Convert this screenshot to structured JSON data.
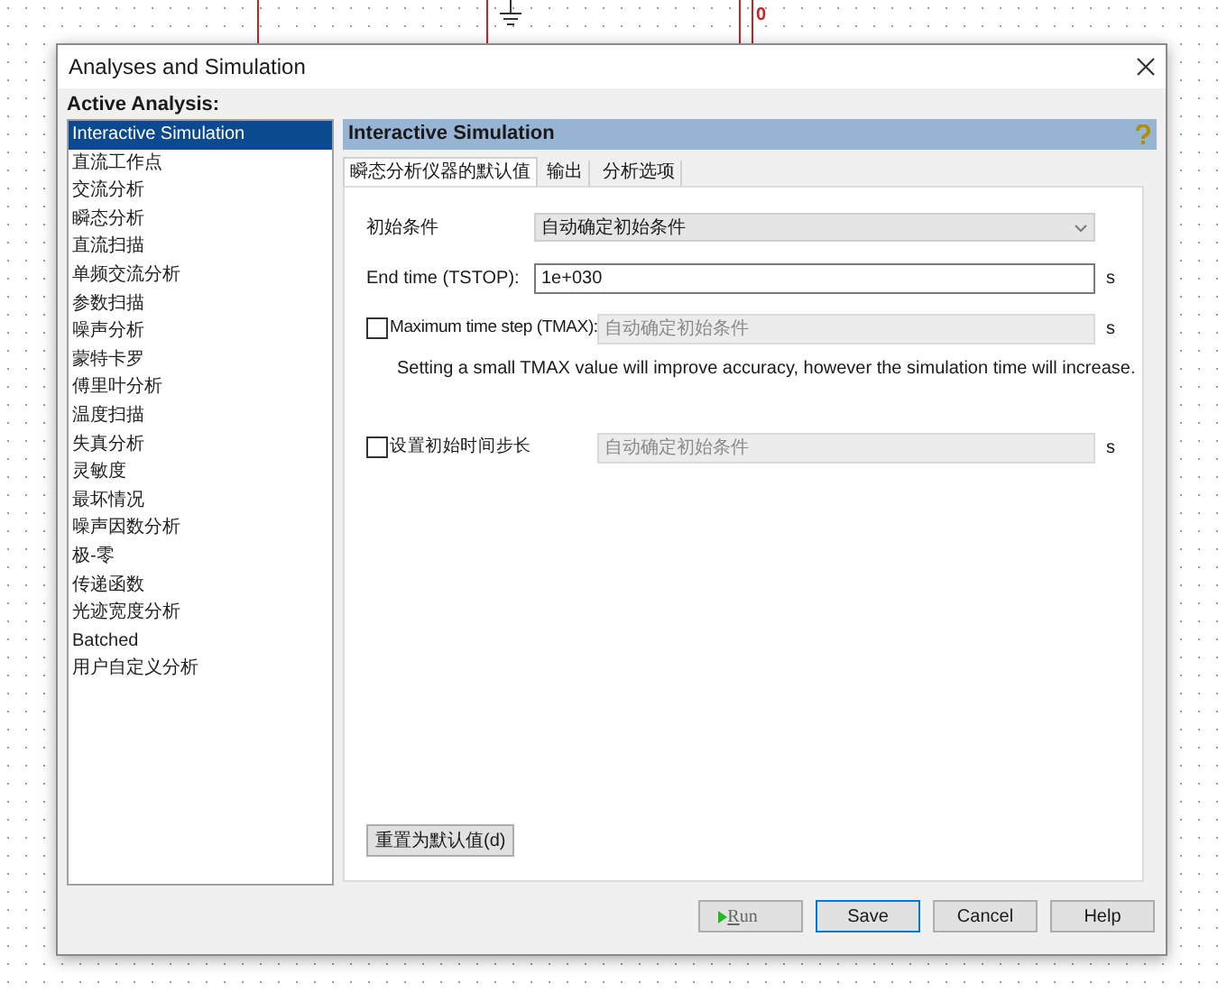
{
  "canvas": {
    "node_label": "0"
  },
  "window": {
    "title": "Analyses and Simulation"
  },
  "sidebar": {
    "heading": "Active Analysis:",
    "items": [
      {
        "label": "Interactive Simulation",
        "selected": true
      },
      {
        "label": "直流工作点",
        "selected": false
      },
      {
        "label": "交流分析",
        "selected": false
      },
      {
        "label": "瞬态分析",
        "selected": false
      },
      {
        "label": "直流扫描",
        "selected": false
      },
      {
        "label": "单频交流分析",
        "selected": false
      },
      {
        "label": "参数扫描",
        "selected": false
      },
      {
        "label": "噪声分析",
        "selected": false
      },
      {
        "label": "蒙特卡罗",
        "selected": false
      },
      {
        "label": "傅里叶分析",
        "selected": false
      },
      {
        "label": "温度扫描",
        "selected": false
      },
      {
        "label": "失真分析",
        "selected": false
      },
      {
        "label": "灵敏度",
        "selected": false
      },
      {
        "label": "最坏情况",
        "selected": false
      },
      {
        "label": "噪声因数分析",
        "selected": false
      },
      {
        "label": "极-零",
        "selected": false
      },
      {
        "label": "传递函数",
        "selected": false
      },
      {
        "label": "光迹宽度分析",
        "selected": false
      },
      {
        "label": "Batched",
        "selected": false
      },
      {
        "label": "用户自定义分析",
        "selected": false
      }
    ]
  },
  "panel": {
    "title": "Interactive Simulation",
    "tabs": [
      {
        "label": "瞬态分析仪器的默认值",
        "selected": true
      },
      {
        "label": "输出",
        "selected": false
      },
      {
        "label": "分析选项",
        "selected": false
      }
    ],
    "fields": [
      {
        "kind": "select",
        "label": "初始条件",
        "value": "自动确定初始条件"
      },
      {
        "kind": "input",
        "label": "End time (TSTOP):",
        "value": "1e+030",
        "unit": "s"
      },
      {
        "kind": "checkbox",
        "label": "Maximum time step (TMAX):",
        "checked": false,
        "disabled": true,
        "value": "自动确定初始条件",
        "unit": "s"
      },
      {
        "kind": "note",
        "text": "Setting a small TMAX value will improve accuracy, however the simulation time will increase."
      },
      {
        "kind": "checkbox",
        "label": "设置初始时间步长",
        "checked": false,
        "disabled": true,
        "value": "自动确定初始条件",
        "unit": "s"
      }
    ],
    "reset_button": "重置为默认值(d)"
  },
  "buttons": [
    {
      "kind": "run",
      "label": "Run",
      "focused": false
    },
    {
      "kind": "plain",
      "label": "Save",
      "focused": true
    },
    {
      "kind": "plain",
      "label": "Cancel",
      "focused": false
    },
    {
      "kind": "plain",
      "label": "Help",
      "focused": false
    }
  ]
}
